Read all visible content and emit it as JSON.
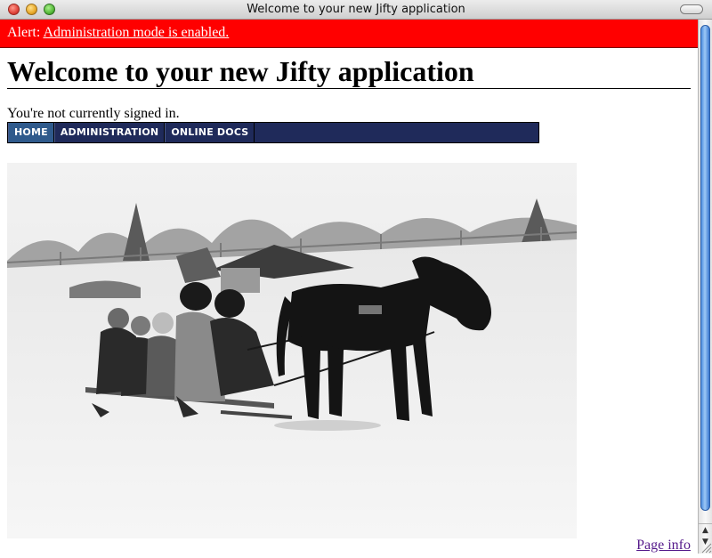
{
  "window": {
    "title": "Welcome to your new Jifty application"
  },
  "alert": {
    "prefix": "Alert:",
    "link_text": "Administration mode is enabled."
  },
  "page": {
    "heading": "Welcome to your new Jifty application",
    "signin_status": "You're not currently signed in."
  },
  "nav": {
    "items": [
      {
        "label": "HOME",
        "active": true
      },
      {
        "label": "ADMINISTRATION",
        "active": false
      },
      {
        "label": "ONLINE DOCS",
        "active": false
      }
    ]
  },
  "photo": {
    "subject": "children-on-sled-pulled-by-pony-in-snow"
  },
  "footer": {
    "page_info": "Page info"
  },
  "colors": {
    "alert_bg": "#ff0000",
    "nav_bg": "#1f2a5a",
    "nav_active": "#2f5a8c",
    "link_visited": "#551a8b",
    "scroll_thumb": "#4e8fe0"
  },
  "icons": {
    "close": "close-icon",
    "minimize": "minimize-icon",
    "zoom": "zoom-icon",
    "toolbar_toggle": "toolbar-toggle-icon",
    "scroll_up": "scroll-up-arrow-icon",
    "scroll_down": "scroll-down-arrow-icon",
    "resize": "resize-grip-icon"
  }
}
